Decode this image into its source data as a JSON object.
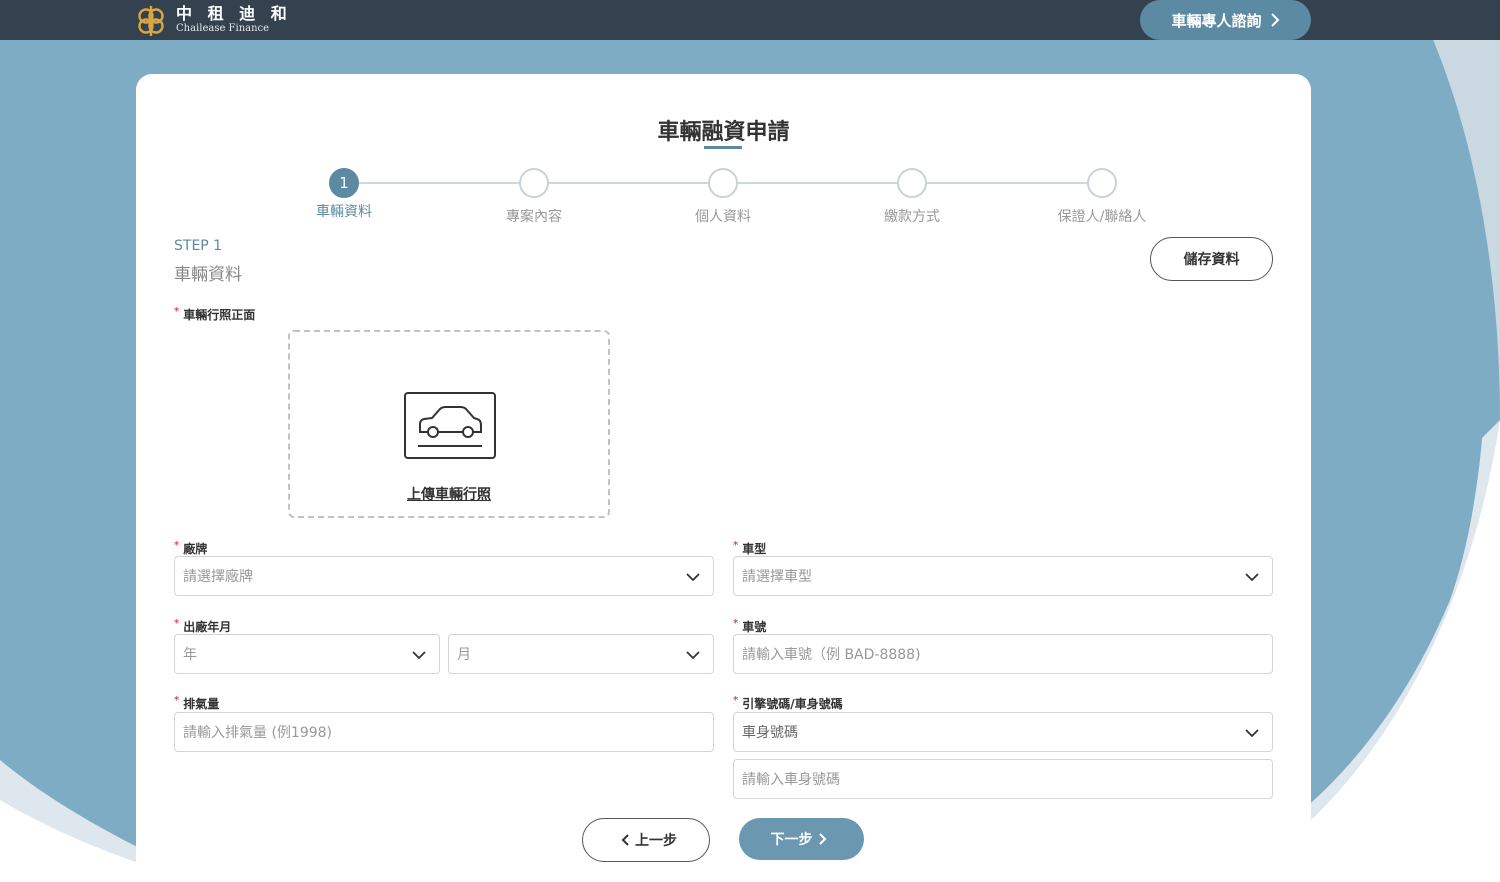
{
  "header": {
    "logo_cn": "中 租 迪 和",
    "logo_en": "Chailease Finance",
    "consult_label": "車輛專人諮詢"
  },
  "page": {
    "title": "車輛融資申請"
  },
  "stepper": {
    "steps": [
      {
        "number": "1",
        "label": "車輛資料"
      },
      {
        "number": "",
        "label": "專案內容"
      },
      {
        "number": "",
        "label": "個人資料"
      },
      {
        "number": "",
        "label": "繳款方式"
      },
      {
        "number": "",
        "label": "保證人/聯絡人"
      }
    ]
  },
  "section": {
    "step_no": "STEP 1",
    "step_name": "車輛資料",
    "save_label": "儲存資料"
  },
  "form": {
    "license_label": "車輛行照正面",
    "upload_label": "上傳車輛行照",
    "brand_label": "廠牌",
    "brand_placeholder": "請選擇廠牌",
    "model_label": "車型",
    "model_placeholder": "請選擇車型",
    "year_month_label": "出廠年月",
    "year_placeholder": "年",
    "month_placeholder": "月",
    "plate_label": "車號",
    "plate_placeholder": "請輸入車號（例 BAD-8888)",
    "displacement_label": "排氣量",
    "displacement_placeholder": "請輸入排氣量 (例1998)",
    "engine_label": "引擎號碼/車身號碼",
    "engine_select_value": "車身號碼",
    "engine_input_placeholder": "請輸入車身號碼"
  },
  "nav": {
    "prev_label": "上一步",
    "next_label": "下一步"
  },
  "colors": {
    "header_bg": "#34424f",
    "accent": "#5c8aa2",
    "bg_blue": "#7eacc4",
    "bg_light": "#dde7ed"
  }
}
